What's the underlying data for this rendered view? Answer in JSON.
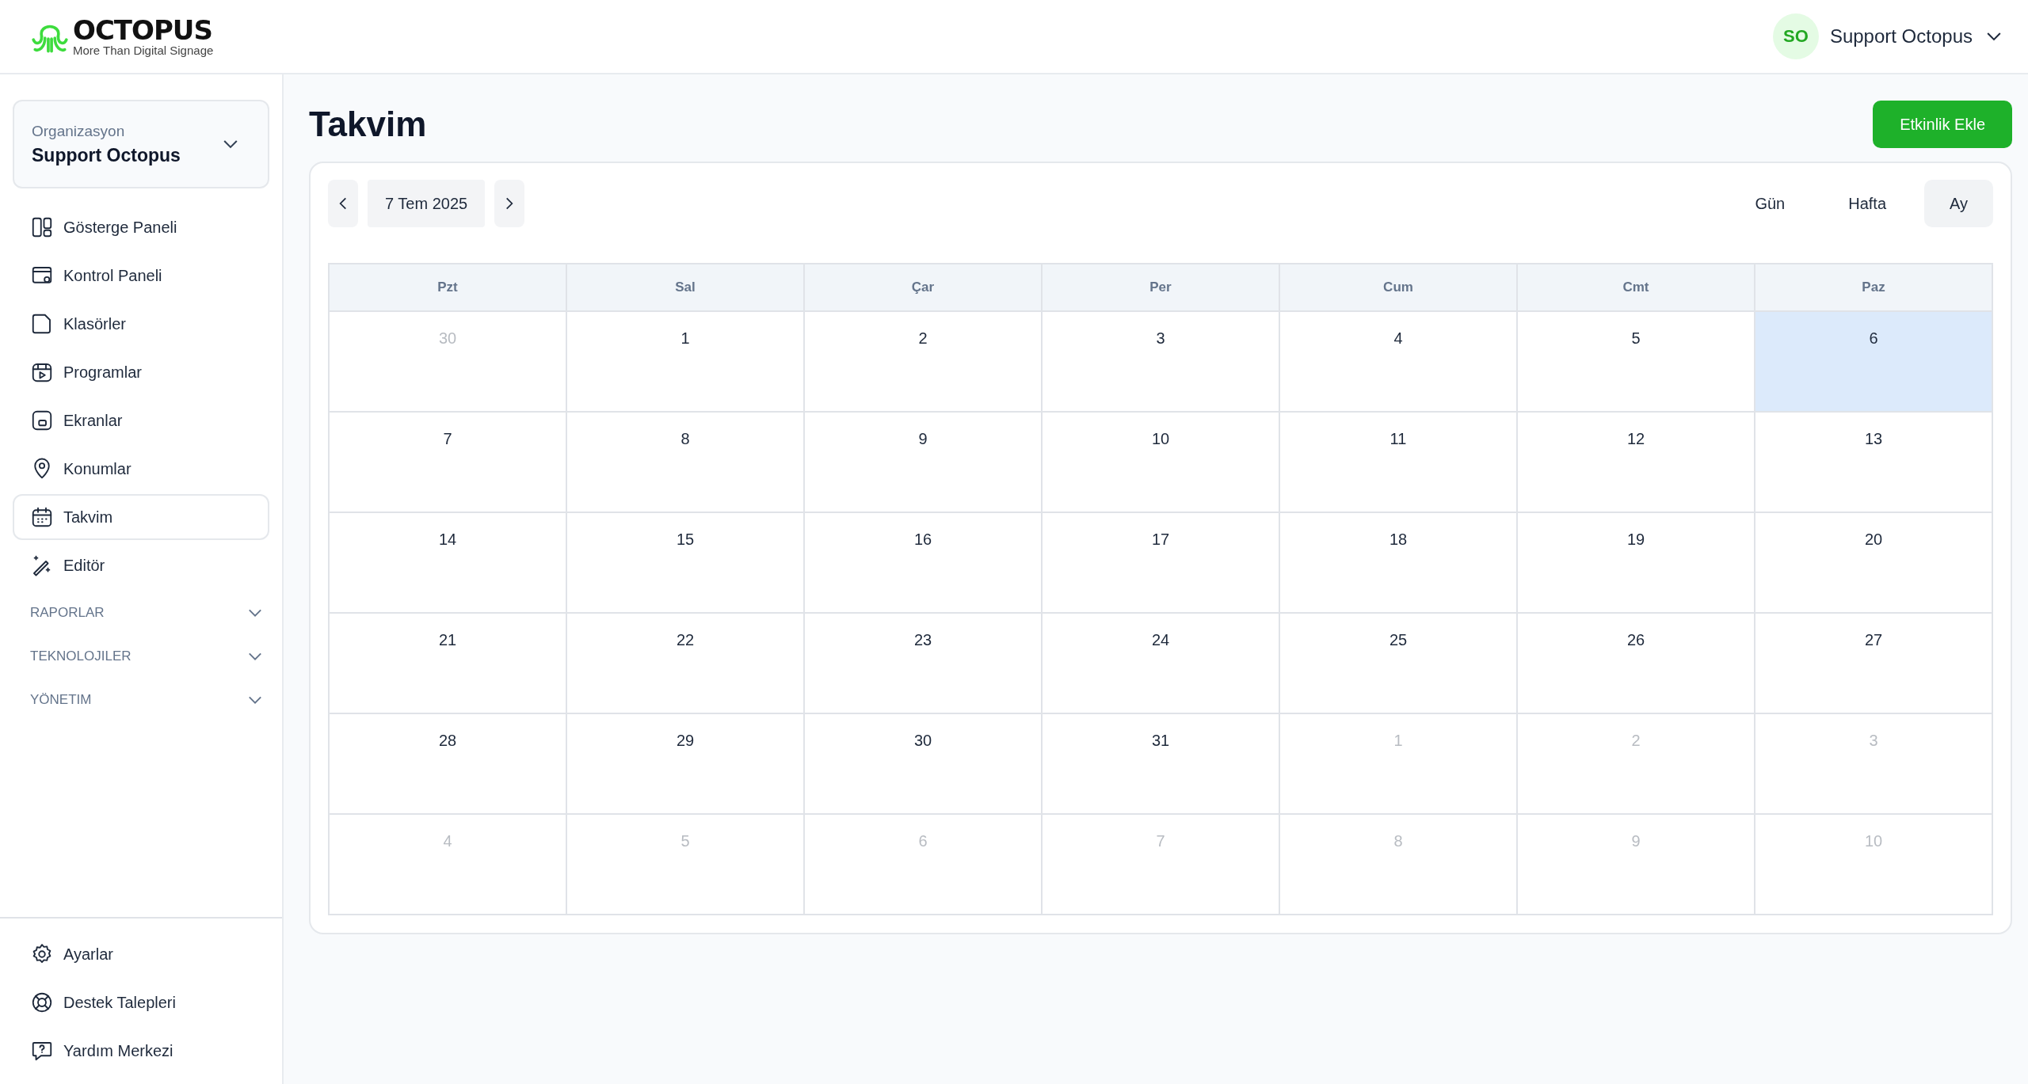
{
  "logo": {
    "name": "OCTOPUS",
    "tagline": "More Than Digital Signage"
  },
  "user": {
    "initials": "SO",
    "name": "Support Octopus"
  },
  "organization": {
    "label": "Organizasyon",
    "value": "Support Octopus"
  },
  "sidebar": {
    "items": [
      {
        "label": "Gösterge Paneli",
        "selected": false
      },
      {
        "label": "Kontrol Paneli",
        "selected": false
      },
      {
        "label": "Klasörler",
        "selected": false
      },
      {
        "label": "Programlar",
        "selected": false
      },
      {
        "label": "Ekranlar",
        "selected": false
      },
      {
        "label": "Konumlar",
        "selected": false
      },
      {
        "label": "Takvim",
        "selected": true
      },
      {
        "label": "Editör",
        "selected": false
      }
    ],
    "sections": [
      {
        "label": "RAPORLAR",
        "expanded": false
      },
      {
        "label": "TEKNOLOJILER",
        "expanded": false
      },
      {
        "label": "YÖNETIM",
        "expanded": false
      }
    ],
    "bottom_items": [
      {
        "label": "Ayarlar"
      },
      {
        "label": "Destek Talepleri"
      },
      {
        "label": "Yardım Merkezi"
      }
    ]
  },
  "page": {
    "title": "Takvim",
    "add_button": "Etkinlik Ekle"
  },
  "calendar": {
    "date": "7 Tem 2025",
    "views": [
      {
        "label": "Gün",
        "selected": false
      },
      {
        "label": "Hafta",
        "selected": false
      },
      {
        "label": "Ay",
        "selected": true
      }
    ],
    "weekdays": [
      "Pzt",
      "Sal",
      "Çar",
      "Per",
      "Cum",
      "Cmt",
      "Paz"
    ],
    "weeks": [
      [
        {
          "day": "30",
          "outside": true,
          "today": false
        },
        {
          "day": "1",
          "outside": false,
          "today": false
        },
        {
          "day": "2",
          "outside": false,
          "today": false
        },
        {
          "day": "3",
          "outside": false,
          "today": false
        },
        {
          "day": "4",
          "outside": false,
          "today": false
        },
        {
          "day": "5",
          "outside": false,
          "today": false
        },
        {
          "day": "6",
          "outside": false,
          "today": true
        }
      ],
      [
        {
          "day": "7",
          "outside": false,
          "today": false
        },
        {
          "day": "8",
          "outside": false,
          "today": false
        },
        {
          "day": "9",
          "outside": false,
          "today": false
        },
        {
          "day": "10",
          "outside": false,
          "today": false
        },
        {
          "day": "11",
          "outside": false,
          "today": false
        },
        {
          "day": "12",
          "outside": false,
          "today": false
        },
        {
          "day": "13",
          "outside": false,
          "today": false
        }
      ],
      [
        {
          "day": "14",
          "outside": false,
          "today": false
        },
        {
          "day": "15",
          "outside": false,
          "today": false
        },
        {
          "day": "16",
          "outside": false,
          "today": false
        },
        {
          "day": "17",
          "outside": false,
          "today": false
        },
        {
          "day": "18",
          "outside": false,
          "today": false
        },
        {
          "day": "19",
          "outside": false,
          "today": false
        },
        {
          "day": "20",
          "outside": false,
          "today": false
        }
      ],
      [
        {
          "day": "21",
          "outside": false,
          "today": false
        },
        {
          "day": "22",
          "outside": false,
          "today": false
        },
        {
          "day": "23",
          "outside": false,
          "today": false
        },
        {
          "day": "24",
          "outside": false,
          "today": false
        },
        {
          "day": "25",
          "outside": false,
          "today": false
        },
        {
          "day": "26",
          "outside": false,
          "today": false
        },
        {
          "day": "27",
          "outside": false,
          "today": false
        }
      ],
      [
        {
          "day": "28",
          "outside": false,
          "today": false
        },
        {
          "day": "29",
          "outside": false,
          "today": false
        },
        {
          "day": "30",
          "outside": false,
          "today": false
        },
        {
          "day": "31",
          "outside": false,
          "today": false
        },
        {
          "day": "1",
          "outside": true,
          "today": false
        },
        {
          "day": "2",
          "outside": true,
          "today": false
        },
        {
          "day": "3",
          "outside": true,
          "today": false
        }
      ],
      [
        {
          "day": "4",
          "outside": true,
          "today": false
        },
        {
          "day": "5",
          "outside": true,
          "today": false
        },
        {
          "day": "6",
          "outside": true,
          "today": false
        },
        {
          "day": "7",
          "outside": true,
          "today": false
        },
        {
          "day": "8",
          "outside": true,
          "today": false
        },
        {
          "day": "9",
          "outside": true,
          "today": false
        },
        {
          "day": "10",
          "outside": true,
          "today": false
        }
      ]
    ]
  }
}
